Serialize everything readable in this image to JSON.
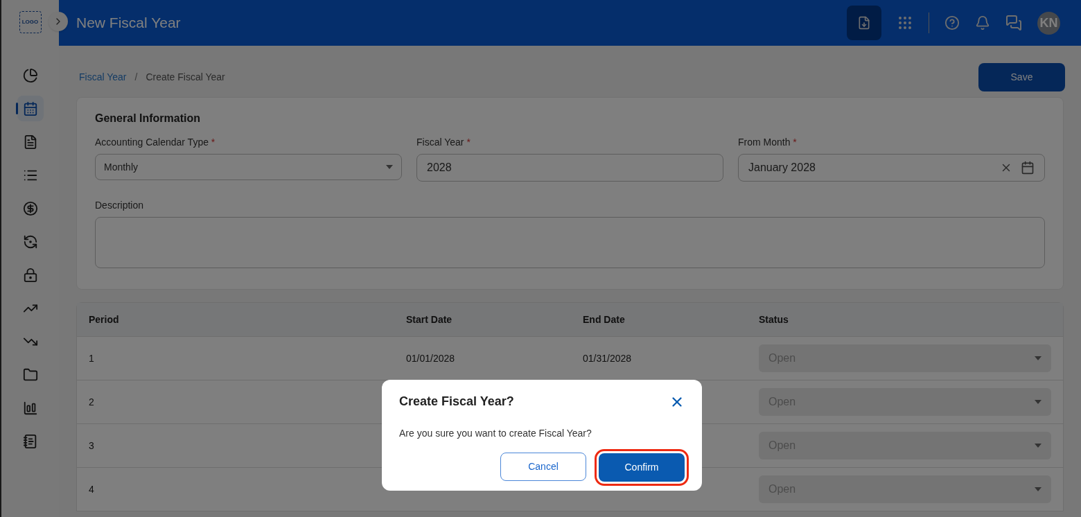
{
  "header": {
    "logo": "LOGO",
    "title": "New Fiscal Year",
    "avatar": "KN"
  },
  "sidebar": {
    "items": [
      {
        "kind": "pie",
        "selected": false
      },
      {
        "kind": "calendar",
        "selected": true
      },
      {
        "kind": "document",
        "selected": false
      },
      {
        "kind": "list",
        "selected": false
      },
      {
        "kind": "dollar",
        "selected": false
      },
      {
        "kind": "exchange",
        "selected": false
      },
      {
        "kind": "lock",
        "selected": false
      },
      {
        "kind": "trend-up",
        "selected": false
      },
      {
        "kind": "trend-down",
        "selected": false
      },
      {
        "kind": "folder",
        "selected": false
      },
      {
        "kind": "chart",
        "selected": false
      },
      {
        "kind": "notes",
        "selected": false
      }
    ]
  },
  "breadcrumb": [
    {
      "label": "Fiscal Year",
      "kind": "link"
    },
    {
      "label": "/",
      "kind": "separator"
    },
    {
      "label": "Create Fiscal Year",
      "kind": "current"
    }
  ],
  "required_mark": "*",
  "save_button": "Save",
  "general": {
    "title": "General Information",
    "fields": [
      {
        "label": "Accounting Calendar Type",
        "required": true,
        "kind": "select",
        "value": "Monthly"
      },
      {
        "label": "Fiscal Year",
        "required": true,
        "kind": "text",
        "value": "2028"
      },
      {
        "label": "From Month",
        "required": true,
        "kind": "date",
        "value": "January 2028"
      }
    ],
    "description": {
      "label": "Description"
    }
  },
  "table": {
    "columns": [
      "Period",
      "Start Date",
      "End Date",
      "Status"
    ],
    "rows": [
      {
        "period": "1",
        "start": "01/01/2028",
        "end": "01/31/2028",
        "status": "Open",
        "disabled": true
      },
      {
        "period": "2",
        "status": "Open",
        "disabled": true
      },
      {
        "period": "3",
        "status": "Open",
        "disabled": true
      },
      {
        "period": "4",
        "status": "Open",
        "disabled": true
      }
    ]
  },
  "dialog": {
    "title": "Create Fiscal Year?",
    "message": "Are you sure you want to create Fiscal Year?",
    "buttons": [
      {
        "label": "Cancel",
        "kind": "secondary",
        "highlighted": false
      },
      {
        "label": "Confirm",
        "kind": "primary",
        "highlighted": true
      }
    ]
  }
}
